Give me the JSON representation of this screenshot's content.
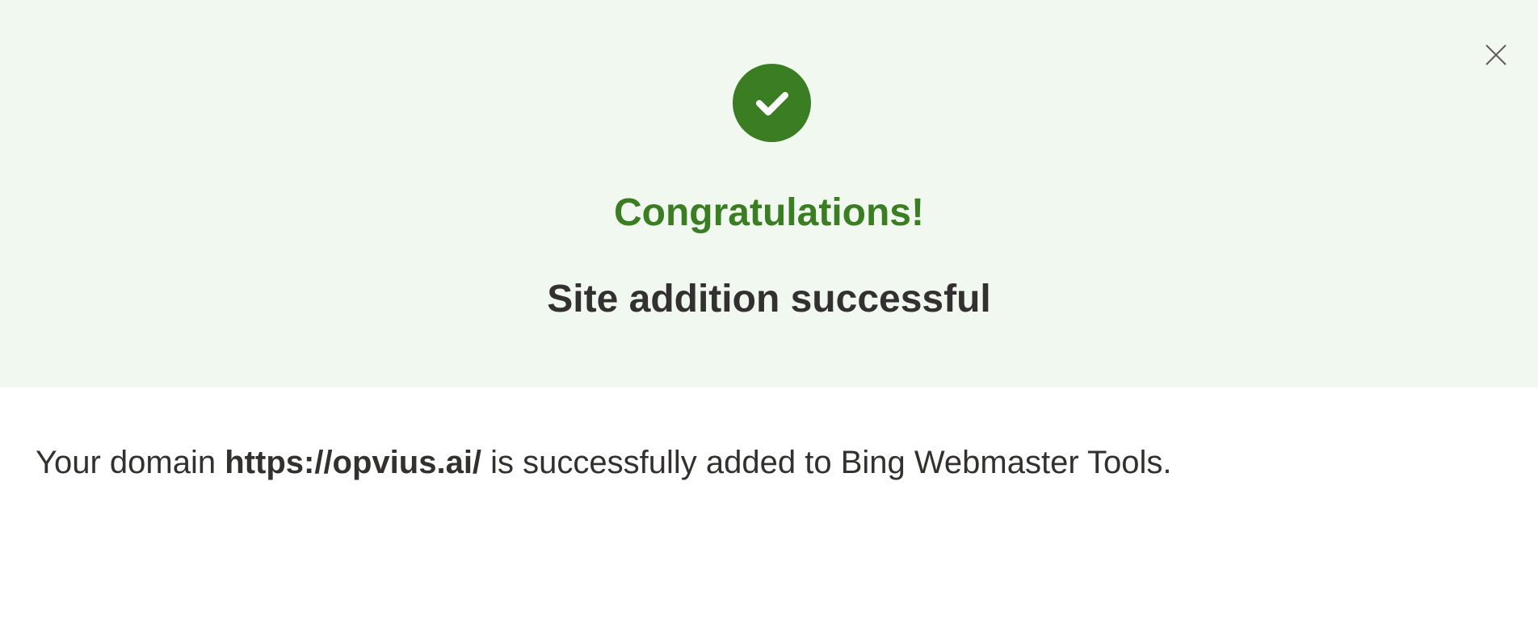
{
  "dialog": {
    "close_icon": "close-icon",
    "success_icon": "checkmark-icon",
    "headline": "Congratulations!",
    "subheadline": "Site addition successful",
    "message": {
      "prefix": "Your domain ",
      "domain": "https://opvius.ai/",
      "suffix": " is successfully added to Bing Webmaster Tools."
    }
  },
  "colors": {
    "banner_background": "#f1f8f0",
    "success_green": "#3a7d23",
    "text_dark": "#323130",
    "close_icon": "#605e5c"
  }
}
